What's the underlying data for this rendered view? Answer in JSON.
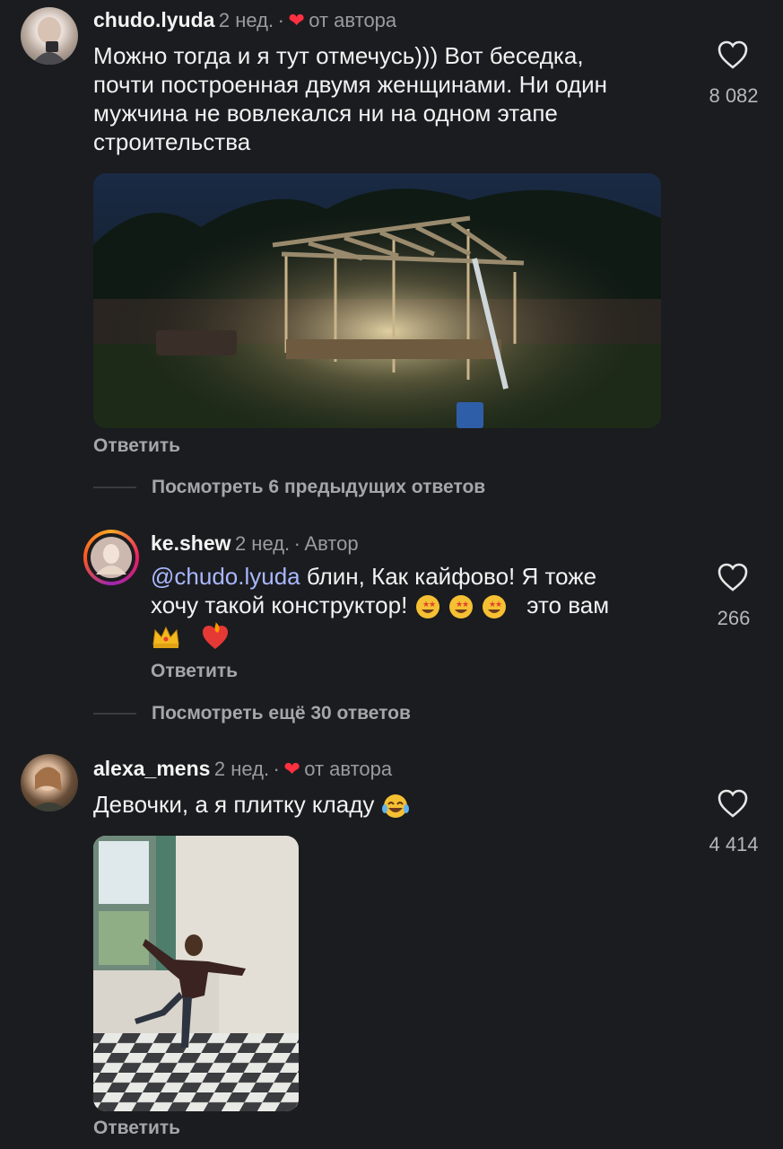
{
  "comments": [
    {
      "username": "chudo.lyuda",
      "time": "2 нед.",
      "sep": "·",
      "author_like": "от автора",
      "text_lines": [
        "Можно тогда и я тут отмечусь))) Вот беседка,",
        "почти построенная двумя женщинами. Ни один",
        "мужчина не вовлекался ни на одном этапе",
        "строительства"
      ],
      "likes": "8 082",
      "reply_label": "Ответить"
    },
    {
      "username": "ke.shew",
      "time": "2 нед.",
      "sep": "·",
      "author_tag": "Автор",
      "mention": "@chudo.lyuda",
      "line1": " блин, Как кайфово! Я тоже",
      "line2": "хочу такой конструктор!",
      "line2_end": "это вам",
      "likes": "266",
      "reply_label": "Ответить"
    },
    {
      "username": "alexa_mens",
      "time": "2 нед.",
      "sep": "·",
      "author_like": "от автора",
      "text": "Девочки, а я плитку кладу",
      "likes": "4 414",
      "reply_label": "Ответить"
    }
  ],
  "view_prev_replies": "Посмотреть 6 предыдущих ответов",
  "view_more_replies": "Посмотреть ещё 30 ответов",
  "icons": {
    "heart_outline": "heart-outline-icon",
    "heart_filled": "heart-filled-icon",
    "star_struck": "star-struck-emoji",
    "crown": "crown-emoji",
    "heart_fire": "heart-on-fire-emoji",
    "laughing": "tears-of-joy-emoji"
  },
  "colors": {
    "background": "#1b1c1f",
    "accent_red": "#ff3040",
    "mention": "#a8b8ff"
  }
}
